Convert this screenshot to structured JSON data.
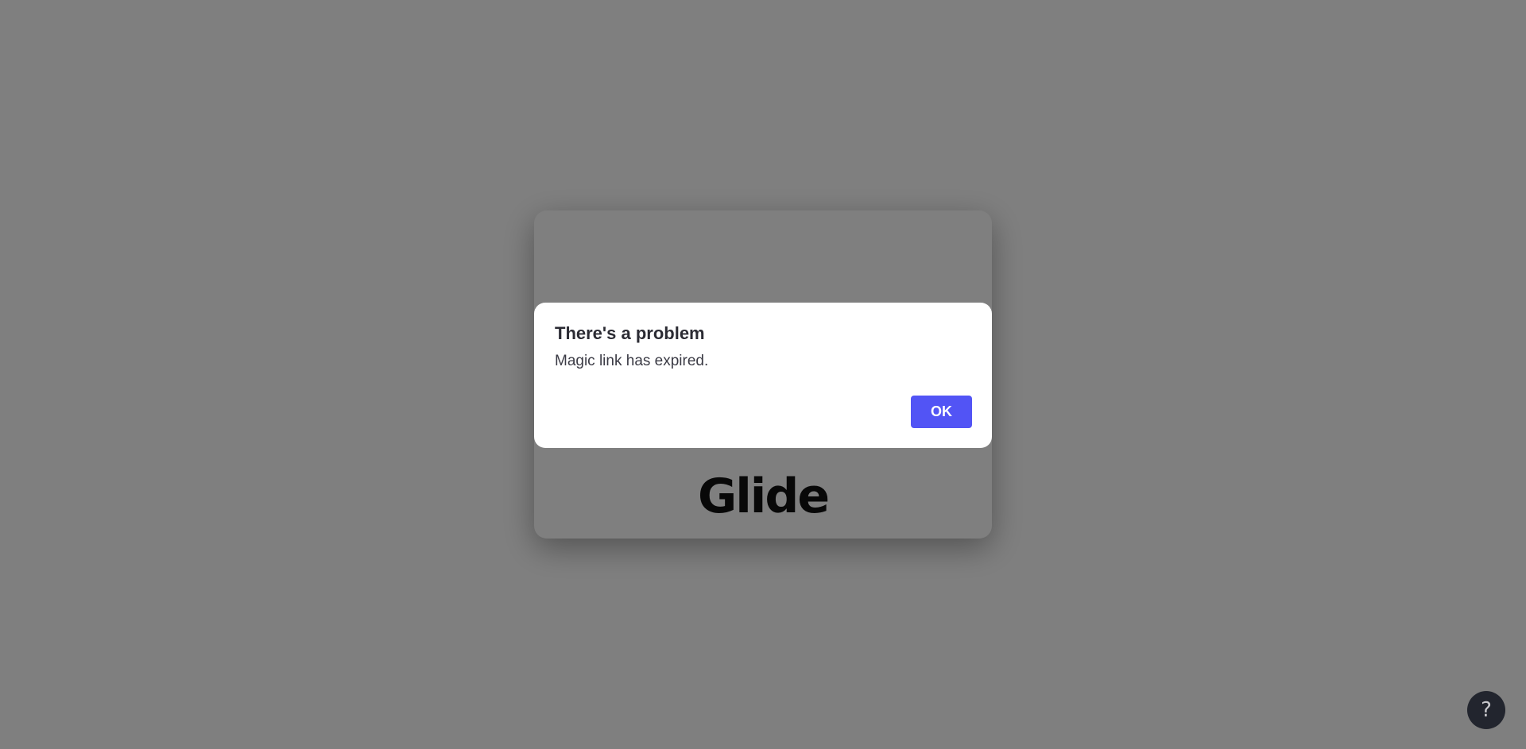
{
  "background": {
    "logo_text": "Glide"
  },
  "dialog": {
    "title": "There's a problem",
    "message": "Magic link has expired.",
    "ok_label": "OK"
  },
  "help": {
    "label": "?"
  },
  "colors": {
    "accent": "#5254f5",
    "overlay": "rgba(0,0,0,0.5)",
    "help_button": "#22252e"
  }
}
